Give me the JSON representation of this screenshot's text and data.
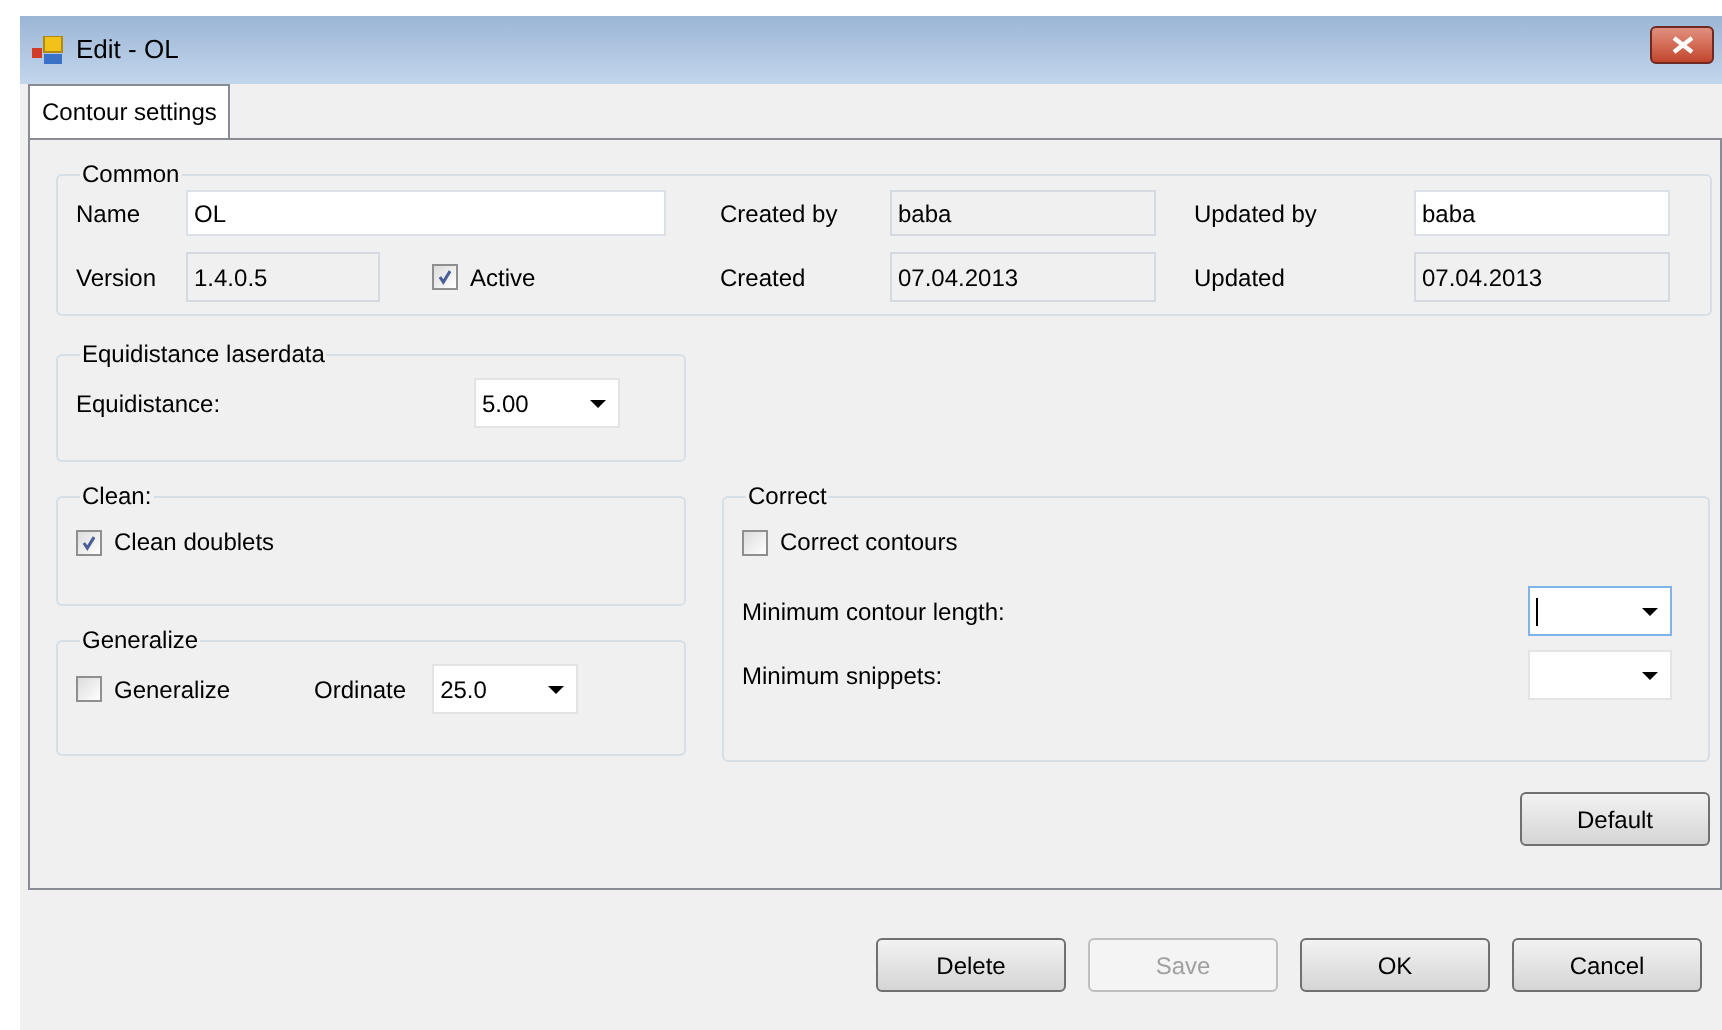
{
  "window": {
    "title": "Edit - OL"
  },
  "tabs": [
    {
      "label": "Contour settings",
      "selected": true
    }
  ],
  "common": {
    "legend": "Common",
    "name": {
      "label": "Name",
      "value": "OL",
      "editable": true
    },
    "version": {
      "label": "Version",
      "value": "1.4.0.5",
      "editable": false
    },
    "active": {
      "label": "Active",
      "checked": true
    },
    "created_by": {
      "label": "Created by",
      "value": "baba",
      "editable": false
    },
    "created": {
      "label": "Created",
      "value": "07.04.2013",
      "editable": false
    },
    "updated_by": {
      "label": "Updated by",
      "value": "baba",
      "editable": true
    },
    "updated": {
      "label": "Updated",
      "value": "07.04.2013",
      "editable": false
    }
  },
  "equidistance": {
    "legend": "Equidistance laserdata",
    "label": "Equidistance:",
    "value": "5.00"
  },
  "clean": {
    "legend": "Clean:",
    "checkbox": {
      "label": "Clean doublets",
      "checked": true
    }
  },
  "generalize": {
    "legend": "Generalize",
    "checkbox": {
      "label": "Generalize",
      "checked": false
    },
    "ordinate_label": "Ordinate",
    "ordinate_value": "25.0"
  },
  "correct": {
    "legend": "Correct",
    "checkbox": {
      "label": "Correct contours",
      "checked": false
    },
    "min_length": {
      "label": "Minimum contour length:",
      "focused": true
    },
    "min_snippets": {
      "label": "Minimum snippets:",
      "focused": false
    }
  },
  "default_button": "Default",
  "buttons": [
    {
      "label": "Delete",
      "disabled": false
    },
    {
      "label": "Save",
      "disabled": true
    },
    {
      "label": "OK",
      "disabled": false
    },
    {
      "label": "Cancel",
      "disabled": false
    }
  ]
}
